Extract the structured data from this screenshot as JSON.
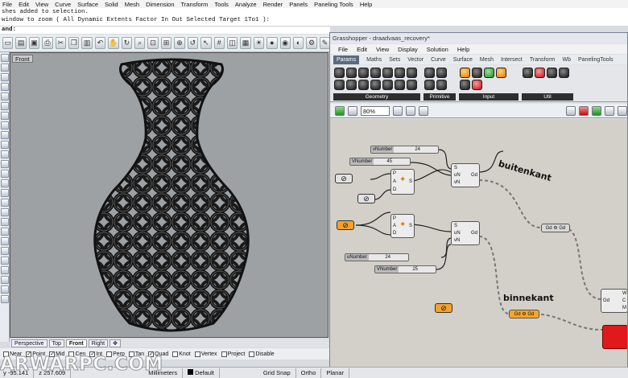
{
  "rhino": {
    "menu": [
      "File",
      "Edit",
      "View",
      "Curve",
      "Surface",
      "Solid",
      "Mesh",
      "Dimension",
      "Transform",
      "Tools",
      "Analyze",
      "Render",
      "Panels",
      "Paneling Tools",
      "Help"
    ],
    "history_line1": "shes added to selection.",
    "history_line2": "window to zoom ( All  Dynamic  Extents  Factor  In  Out  Selected  Target  1To1 ):",
    "command_label": "and:",
    "viewport_title": "Front",
    "viewport_tabs": [
      "Perspective",
      "Top",
      "Front",
      "Right"
    ],
    "osnaps": [
      {
        "label": "Near",
        "checked": false
      },
      {
        "label": "Point",
        "checked": true
      },
      {
        "label": "Mid",
        "checked": true
      },
      {
        "label": "Cen",
        "checked": false
      },
      {
        "label": "Int",
        "checked": true
      },
      {
        "label": "Perp",
        "checked": false
      },
      {
        "label": "Tan",
        "checked": false
      },
      {
        "label": "Quad",
        "checked": true
      },
      {
        "label": "Knot",
        "checked": false
      },
      {
        "label": "Vertex",
        "checked": false
      },
      {
        "label": "Project",
        "checked": false
      },
      {
        "label": "Disable",
        "checked": false
      }
    ],
    "status": {
      "x": "y -95.141",
      "y": "z 257.609",
      "units": "Millimeters",
      "layer": "Default",
      "grid_snap": "Grid Snap",
      "ortho": "Ortho",
      "planar": "Planar"
    },
    "watermark": "ARWARPC.COM"
  },
  "grasshopper": {
    "title": "Grasshopper - draadvaas_recovery*",
    "menu": [
      "File",
      "Edit",
      "View",
      "Display",
      "Solution",
      "Help"
    ],
    "tabs": [
      "Params",
      "Maths",
      "Sets",
      "Vector",
      "Curve",
      "Surface",
      "Mesh",
      "Intersect",
      "Transform",
      "Wb",
      "PanelingTools"
    ],
    "active_tab": "Params",
    "ribbon_groups": [
      "Geometry",
      "Primitive",
      "Input",
      "Util"
    ],
    "zoom": "80%",
    "sliders": [
      {
        "name": "vNumber",
        "value": "24"
      },
      {
        "name": "VNumber",
        "value": "45"
      },
      {
        "name": "uNumber",
        "value": "24"
      },
      {
        "name": "VNumber",
        "value": "25"
      }
    ],
    "comp_inputs_top": [
      "S",
      "uN",
      "vN"
    ],
    "comp_output_gd": "Gd",
    "comp_inputs_pad": [
      "P",
      "A",
      "D"
    ],
    "comp_output_s": "S",
    "labels": {
      "outer": "buitenkant",
      "inner": "binnekant"
    },
    "mid_param": "Gd",
    "right_inputs": [
      "W",
      "C",
      "M"
    ],
    "accent_orange": "#f5a22c",
    "accent_red": "#e01a1a"
  }
}
